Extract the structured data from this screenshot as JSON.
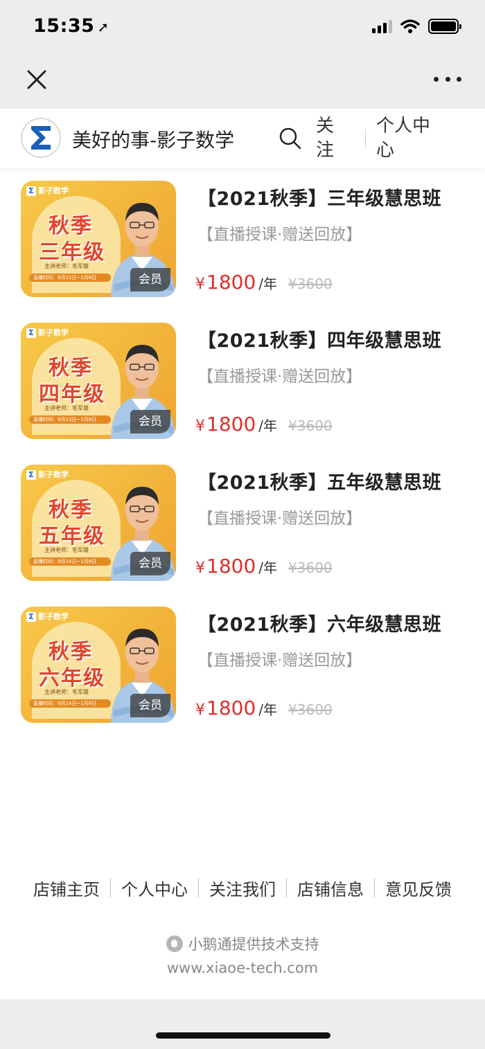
{
  "status_bar": {
    "time": "15:35",
    "location_glyph": "➚"
  },
  "nav": {
    "close_icon": "close-icon",
    "more_icon": "more-icon"
  },
  "shop": {
    "name": "美好的事-影子数学",
    "follow_label": "关注",
    "center_label": "个人中心"
  },
  "courses": [
    {
      "title": "【2021秋季】三年级慧思班",
      "subtitle": "【直播授课·赠送回放】",
      "currency": "¥",
      "price": "1800",
      "unit": "/年",
      "original_price": "¥3600",
      "thumb": {
        "brand": "影子数学",
        "line1": "秋季",
        "line2": "三年级",
        "teacher": "主讲老师：毛军雄",
        "dates": "直播时间：9月11日~1月8日",
        "badge": "会员"
      }
    },
    {
      "title": "【2021秋季】四年级慧思班",
      "subtitle": "【直播授课·赠送回放】",
      "currency": "¥",
      "price": "1800",
      "unit": "/年",
      "original_price": "¥3600",
      "thumb": {
        "brand": "影子数学",
        "line1": "秋季",
        "line2": "四年级",
        "teacher": "主讲老师：毛军雄",
        "dates": "直播时间：9月13日~1月8日",
        "badge": "会员"
      }
    },
    {
      "title": "【2021秋季】五年级慧思班",
      "subtitle": "【直播授课·赠送回放】",
      "currency": "¥",
      "price": "1800",
      "unit": "/年",
      "original_price": "¥3600",
      "thumb": {
        "brand": "影子数学",
        "line1": "秋季",
        "line2": "五年级",
        "teacher": "主讲老师：毛军雄",
        "dates": "直播时间：9月14日~1月8日",
        "badge": "会员"
      }
    },
    {
      "title": "【2021秋季】六年级慧思班",
      "subtitle": "【直播授课·赠送回放】",
      "currency": "¥",
      "price": "1800",
      "unit": "/年",
      "original_price": "¥3600",
      "thumb": {
        "brand": "影子数学",
        "line1": "秋季",
        "line2": "六年级",
        "teacher": "主讲老师：毛军雄",
        "dates": "直播时间：9月14日~1月8日",
        "badge": "会员"
      }
    }
  ],
  "footer": {
    "links": [
      "店铺主页",
      "个人中心",
      "关注我们",
      "店铺信息",
      "意见反馈"
    ],
    "powered_by": "小鹅通提供技术支持",
    "url": "www.xiaoe-tech.com"
  },
  "colors": {
    "price_red": "#e02e2e",
    "logo_blue": "#1a5fb8",
    "thumb_yellow": "#f2b23a"
  }
}
